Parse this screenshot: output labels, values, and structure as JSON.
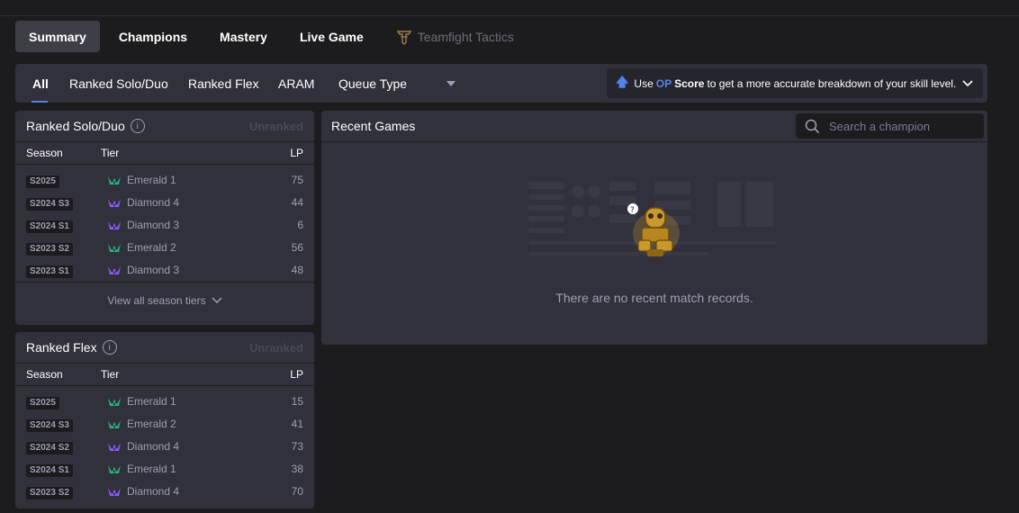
{
  "main_tabs": [
    {
      "label": "Summary",
      "active": true
    },
    {
      "label": "Champions"
    },
    {
      "label": "Mastery"
    },
    {
      "label": "Live Game"
    },
    {
      "label": "Teamfight Tactics",
      "dim": true
    }
  ],
  "queue_tabs": {
    "all": "All",
    "solo": "Ranked Solo/Duo",
    "flex": "Ranked Flex",
    "aram": "ARAM",
    "queue_type": "Queue Type"
  },
  "op_banner": {
    "prefix": "Use",
    "op": "OP",
    "score": "Score",
    "suffix": "to get a more accurate breakdown of your skill level."
  },
  "colors": {
    "accent": "#5383e8",
    "emerald": "#2daf7f",
    "diamond": "#8a5cf6"
  },
  "solo": {
    "title": "Ranked Solo/Duo",
    "status": "Unranked",
    "headers": {
      "season": "Season",
      "tier": "Tier",
      "lp": "LP"
    },
    "rows": [
      {
        "season": "S2025",
        "tier": "Emerald 1",
        "lp": "75",
        "icon": "emerald"
      },
      {
        "season": "S2024 S3",
        "tier": "Diamond 4",
        "lp": "44",
        "icon": "diamond"
      },
      {
        "season": "S2024 S1",
        "tier": "Diamond 3",
        "lp": "6",
        "icon": "diamond"
      },
      {
        "season": "S2023 S2",
        "tier": "Emerald 2",
        "lp": "56",
        "icon": "emerald"
      },
      {
        "season": "S2023 S1",
        "tier": "Diamond 3",
        "lp": "48",
        "icon": "diamond"
      }
    ],
    "view_all": "View all season tiers"
  },
  "flex": {
    "title": "Ranked Flex",
    "status": "Unranked",
    "headers": {
      "season": "Season",
      "tier": "Tier",
      "lp": "LP"
    },
    "rows": [
      {
        "season": "S2025",
        "tier": "Emerald 1",
        "lp": "15",
        "icon": "emerald"
      },
      {
        "season": "S2024 S3",
        "tier": "Emerald 2",
        "lp": "41",
        "icon": "emerald"
      },
      {
        "season": "S2024 S2",
        "tier": "Diamond 4",
        "lp": "73",
        "icon": "diamond"
      },
      {
        "season": "S2024 S1",
        "tier": "Emerald 1",
        "lp": "38",
        "icon": "emerald"
      },
      {
        "season": "S2023 S2",
        "tier": "Diamond 4",
        "lp": "70",
        "icon": "diamond"
      }
    ]
  },
  "recent": {
    "title": "Recent Games",
    "search_placeholder": "Search a champion",
    "empty_text": "There are no recent match records."
  }
}
